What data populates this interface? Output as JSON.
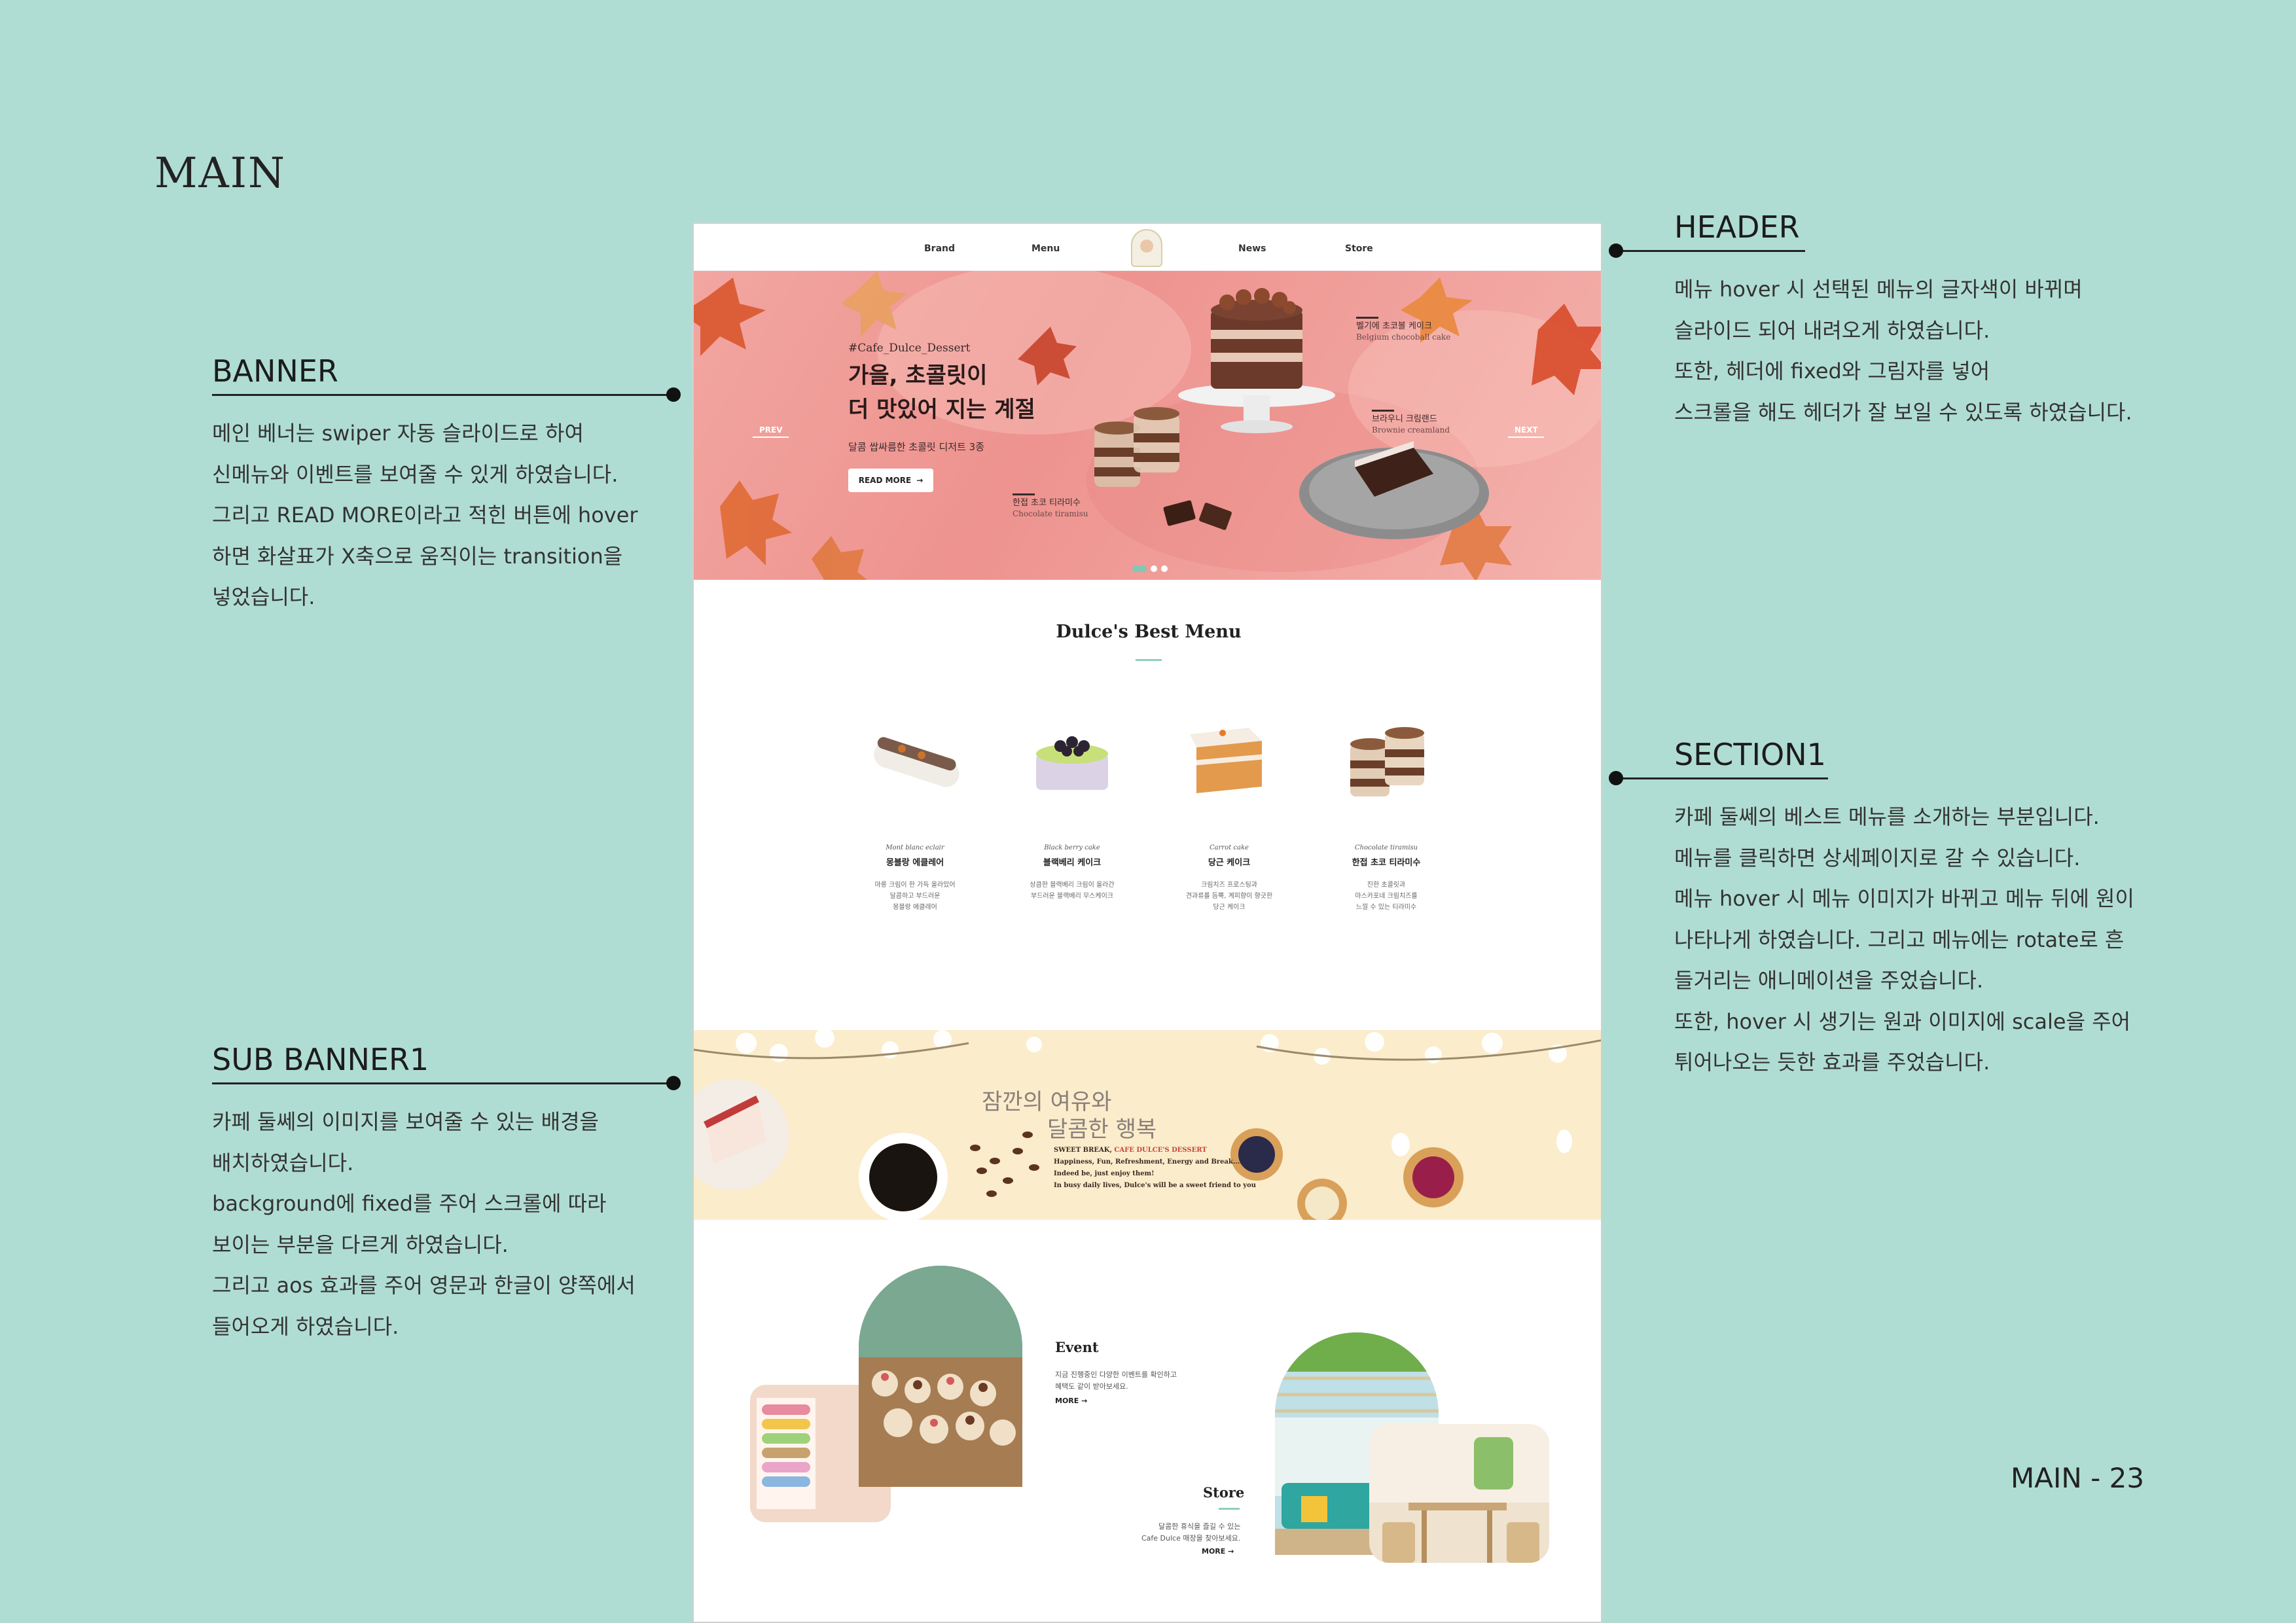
{
  "board": {
    "title": "MAIN",
    "page_number": "MAIN - 23"
  },
  "notes": {
    "banner": {
      "title": "BANNER",
      "body": "메인 베너는 swiper 자동 슬라이드로 하여\n신메뉴와 이벤트를 보여줄 수 있게 하였습니다.\n그리고 READ MORE이라고 적힌 버튼에 hover\n하면 화살표가 X축으로 움직이는 transition을\n넣었습니다."
    },
    "sub_banner": {
      "title": "SUB BANNER1",
      "body": "카페 둘쎄의 이미지를 보여줄 수 있는 배경을\n배치하였습니다.\nbackground에 fixed를 주어 스크롤에 따라\n보이는 부분을 다르게 하였습니다.\n그리고 aos 효과를 주어 영문과 한글이 양쪽에서\n들어오게 하였습니다."
    },
    "header": {
      "title": "HEADER",
      "body": "메뉴 hover 시 선택된 메뉴의 글자색이 바뀌며\n슬라이드 되어 내려오게 하였습니다.\n또한, 헤더에 fixed와 그림자를 넣어\n스크롤을 해도 헤더가 잘 보일 수 있도록 하였습니다."
    },
    "section1": {
      "title": "SECTION1",
      "body": "카페 둘쎄의 베스트 메뉴를 소개하는 부분입니다.\n메뉴를 클릭하면 상세페이지로 갈 수 있습니다.\n메뉴 hover 시 메뉴 이미지가 바뀌고 메뉴 뒤에 원이\n나타나게 하였습니다. 그리고 메뉴에는 rotate로 흔\n들거리는 애니메이션을 주었습니다.\n또한, hover 시 생기는 원과 이미지에 scale을 주어\n튀어나오는 듯한 효과를 주었습니다."
    }
  },
  "mock": {
    "nav": [
      "Brand",
      "Menu",
      "News",
      "Store"
    ],
    "banner": {
      "tag": "#Cafe_Dulce_Dessert",
      "headline_1": "가을, 초콜릿이",
      "headline_2": "더 맛있어 지는 계절",
      "subtitle": "달콤 쌉싸름한 초콜릿 디저트 3종",
      "read_more": "READ MORE",
      "prev": "PREV",
      "next": "NEXT",
      "labels": [
        {
          "ko": "벨기에 초코볼 케이크",
          "en": "Belgium chocoball cake"
        },
        {
          "ko": "브라우니 크림랜드",
          "en": "Brownie creamland"
        },
        {
          "ko": "한접 초코 티라미수",
          "en": "Chocolate tiramisu"
        }
      ]
    },
    "best_menu": {
      "title": "Dulce's Best Menu",
      "items": [
        {
          "en": "Mont blanc eclair",
          "ko": "몽블랑 에클레어",
          "desc": "마롱 크림이 한 가득 올라있어\n달콤하고 부드러운\n몽블랑 에클레어"
        },
        {
          "en": "Black berry cake",
          "ko": "블랙베리 케이크",
          "desc": "상큼한 블랙베리 크림이 올라간\n부드러운 블랙베리 무스케이크"
        },
        {
          "en": "Carrot cake",
          "ko": "당근 케이크",
          "desc": "크림치즈 프로스팅과\n견과류를 듬뿍, 계피향이 향긋한\n당근 케이크"
        },
        {
          "en": "Chocolate tiramisu",
          "ko": "한접 초코 티라미수",
          "desc": "진한 초콜릿과\n마스카포네 크림치즈를\n느낄 수 있는 티라미수"
        }
      ]
    },
    "sub_banner": {
      "line1": "잠깐의 여유와",
      "line2": "달콤한 행복",
      "en_1": "SWEET BREAK,",
      "en_1_accent": "CAFE DULCE'S DESSERT",
      "en_2": "Happiness, Fun, Refreshment, Energy and Break....",
      "en_3": "Indeed be, just enjoy them!",
      "en_4": "In busy daily lives, Dulce's will be a sweet friend to you"
    },
    "event": {
      "title": "Event",
      "desc": "지금 진행중인 다양한 이벤트를 확인하고\n혜택도 같이 받아보세요.",
      "more": "MORE"
    },
    "store": {
      "title": "Store",
      "desc": "달콤한 휴식을 즐길 수 있는\nCafe Dulce 매장을 찾아보세요.",
      "more": "MORE"
    }
  },
  "colors": {
    "board_bg": "#b0ddd3",
    "banner_bg": "#f0a09b",
    "accent_mint": "#8fd0bf",
    "sub_banner_bg": "#fbeccb"
  }
}
